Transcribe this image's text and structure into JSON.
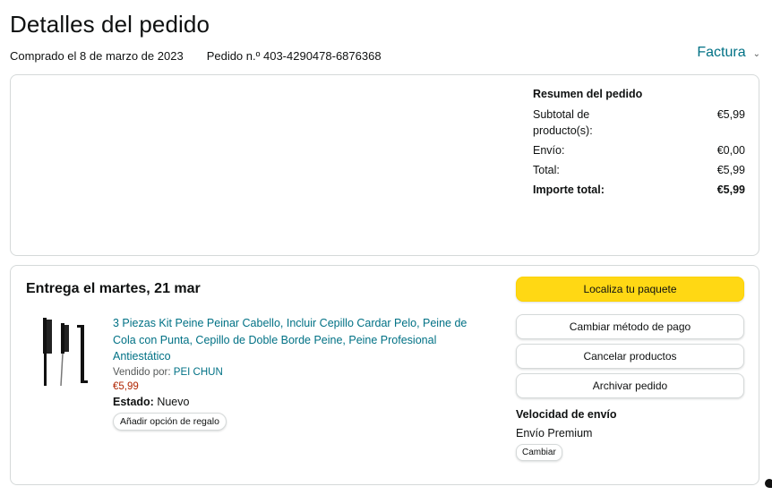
{
  "header": {
    "title": "Detalles del pedido",
    "purchased": "Comprado el 8 de marzo de 2023",
    "order_number": "Pedido n.º 403-4290478-6876368",
    "invoice_label": "Factura",
    "invoice_icon": "chevron-down-icon"
  },
  "summary": {
    "title": "Resumen del pedido",
    "rows": [
      {
        "label": "Subtotal de producto(s):",
        "value": "€5,99"
      },
      {
        "label": "Envío:",
        "value": "€0,00"
      },
      {
        "label": "Total:",
        "value": "€5,99"
      },
      {
        "label": "Importe total:",
        "value": "€5,99"
      }
    ]
  },
  "shipment": {
    "delivery_title": "Entrega el martes, 21 mar",
    "product": {
      "title": "3 Piezas Kit Peine Peinar Cabello, Incluir Cepillo Cardar Pelo, Peine de Cola con Punta, Cepillo de Doble Borde Peine, Peine Profesional Antiestático",
      "sold_by_label": "Vendido por:",
      "seller": "PEI CHUN",
      "price": "€5,99",
      "condition_label": "Estado:",
      "condition_value": "Nuevo",
      "gift_button": "Añadir opción de regalo"
    },
    "actions": {
      "track": "Localiza tu paquete",
      "change_payment": "Cambiar método de pago",
      "cancel": "Cancelar productos",
      "archive": "Archivar pedido"
    },
    "shipping_speed": {
      "title": "Velocidad de envío",
      "value": "Envío Premium",
      "change_button": "Cambiar"
    }
  },
  "colors": {
    "link": "#007185",
    "price": "#b12704",
    "primary_button": "#ffd814",
    "border": "#d5d9d9"
  }
}
